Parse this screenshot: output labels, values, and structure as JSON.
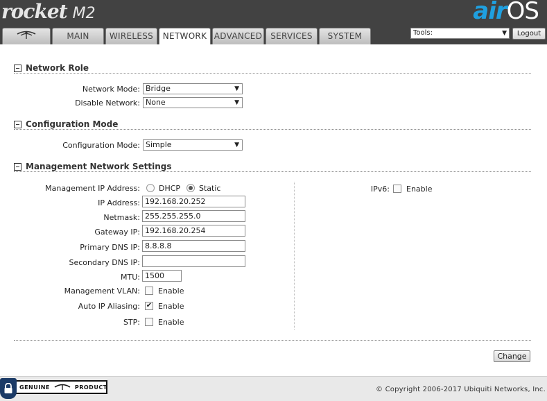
{
  "header": {
    "brand": "rocket",
    "model": "M2",
    "logo_air": "air",
    "logo_os": "OS",
    "tabs": [
      {
        "label": "",
        "icon": "ubiquiti-antenna-icon"
      },
      {
        "label": "MAIN"
      },
      {
        "label": "WIRELESS"
      },
      {
        "label": "NETWORK",
        "active": true
      },
      {
        "label": "ADVANCED"
      },
      {
        "label": "SERVICES"
      },
      {
        "label": "SYSTEM"
      }
    ],
    "tools_label": "Tools:",
    "logout_label": "Logout"
  },
  "network_role": {
    "title": "Network Role",
    "network_mode_label": "Network Mode:",
    "network_mode_value": "Bridge",
    "disable_network_label": "Disable Network:",
    "disable_network_value": "None"
  },
  "configuration_mode": {
    "title": "Configuration Mode",
    "label": "Configuration Mode:",
    "value": "Simple"
  },
  "management": {
    "title": "Management Network Settings",
    "ip_mode_label": "Management IP Address:",
    "dhcp_label": "DHCP",
    "static_label": "Static",
    "ip_label": "IP Address:",
    "ip_value": "192.168.20.252",
    "netmask_label": "Netmask:",
    "netmask_value": "255.255.255.0",
    "gateway_label": "Gateway IP:",
    "gateway_value": "192.168.20.254",
    "primary_dns_label": "Primary DNS IP:",
    "primary_dns_value": "8.8.8.8",
    "secondary_dns_label": "Secondary DNS IP:",
    "secondary_dns_value": "",
    "mtu_label": "MTU:",
    "mtu_value": "1500",
    "vlan_label": "Management VLAN:",
    "aliasing_label": "Auto IP Aliasing:",
    "stp_label": "STP:",
    "ipv6_label": "IPv6:",
    "enable_label": "Enable"
  },
  "actions": {
    "change_label": "Change"
  },
  "footer": {
    "genuine_left": "GENUINE",
    "genuine_right": "PRODUCT",
    "copyright": "© Copyright 2006-2017 Ubiquiti Networks, Inc."
  },
  "colors": {
    "header_bg": "#424242",
    "logo_air": "#1fa0e0",
    "footer_bg": "#e9e9e9"
  }
}
